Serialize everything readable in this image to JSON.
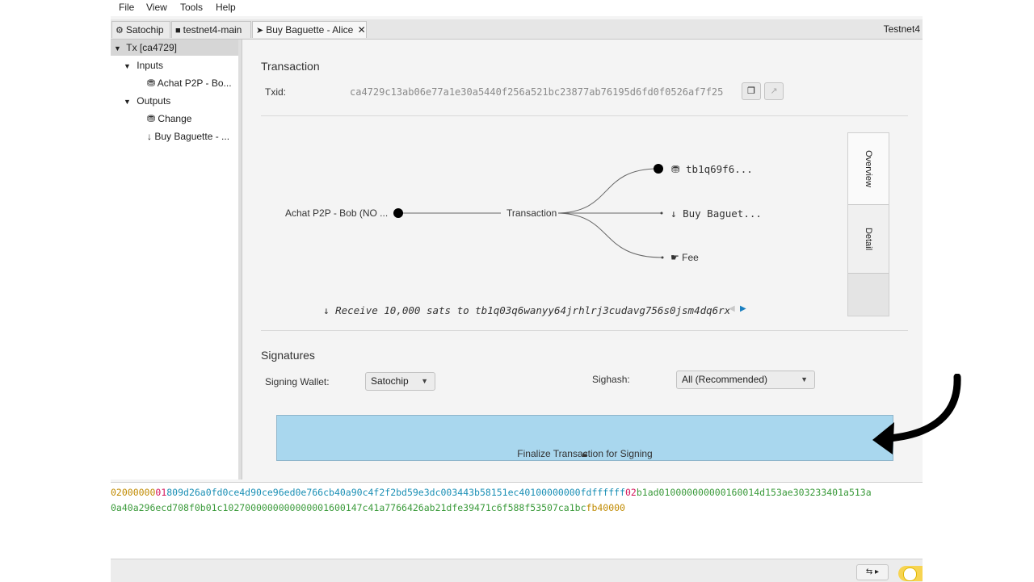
{
  "menu": [
    "File",
    "View",
    "Tools",
    "Help"
  ],
  "tabs": [
    {
      "icon": "⚙",
      "label": "Satochip"
    },
    {
      "icon": "■",
      "label": "testnet4-main"
    },
    {
      "icon": "➤",
      "label": "Buy Baguette - Alice",
      "close": "✕"
    }
  ],
  "network": "Testnet4",
  "tree": {
    "root": "Tx [ca4729]",
    "inputs_label": "Inputs",
    "input_item": "Achat P2P - Bo...",
    "outputs_label": "Outputs",
    "output_change": "Change",
    "output_buy": "Buy Baguette - ..."
  },
  "transaction": {
    "heading": "Transaction",
    "txid_label": "Txid:",
    "txid": "ca4729c13ab06e77a1e30a5440f256a521bc23877ab76195d6fd0f0526af7f25"
  },
  "diagram": {
    "input_label": "Achat P2P - Bob (NO ...",
    "center_label": "Transaction",
    "output1": "tb1q69f6...",
    "output2": "Buy Baguet...",
    "fee": "Fee",
    "detail_line": "Receive 10,000 sats to tb1q03q6wanyy64jrhlrj3cudavg756s0jsm4dq6rx"
  },
  "side_tabs": [
    "Overview",
    "Detail"
  ],
  "signatures": {
    "heading": "Signatures",
    "wallet_label": "Signing Wallet:",
    "wallet_value": "Satochip",
    "sighash_label": "Sighash:",
    "sighash_value": "All (Recommended)",
    "finalize_label": "Finalize Transaction for Signing"
  },
  "hex": {
    "line1": [
      {
        "text": "02000000",
        "color": "#c08a00"
      },
      {
        "text": "01",
        "color": "#d4145a"
      },
      {
        "text": "809d26a0fd0ce4d90ce96ed0e766cb40a90c4f2f2bd59e3dc003443b58151ec4",
        "color": "#1a8fb5"
      },
      {
        "text": "01000000",
        "color": "#1a8fb5"
      },
      {
        "text": "00",
        "color": "#1a8fb5"
      },
      {
        "text": "fdffffff",
        "color": "#1a8fb5"
      },
      {
        "text": "02",
        "color": "#d4145a"
      },
      {
        "text": "b1ad010000000000160014d153ae303233401a513a",
        "color": "#3a9a3a"
      }
    ],
    "line2": [
      {
        "text": "0a40a296ecd708f0b01c1027000000000000001600147c41a7766426ab21dfe39471c6f588f53507ca1bc",
        "color": "#3a9a3a"
      },
      {
        "text": "fb40000",
        "color": "#c08a00"
      }
    ]
  },
  "colors": {
    "finalize_bg": "#a9d7ee",
    "hex_version": "#c08a00",
    "hex_count": "#d4145a",
    "hex_input": "#1a8fb5",
    "hex_output": "#3a9a3a"
  }
}
